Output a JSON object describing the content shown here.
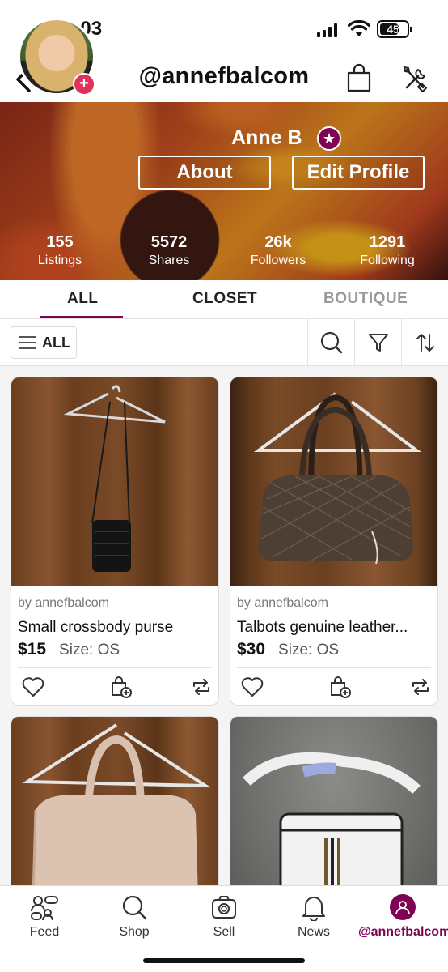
{
  "status": {
    "time": "3:03",
    "battery": "45"
  },
  "header": {
    "handle": "@annefbalcom"
  },
  "profile": {
    "name": "Anne B",
    "about_label": "About",
    "edit_label": "Edit Profile",
    "stats": [
      {
        "value": "155",
        "label": "Listings"
      },
      {
        "value": "5572",
        "label": "Shares"
      },
      {
        "value": "26k",
        "label": "Followers"
      },
      {
        "value": "1291",
        "label": "Following"
      }
    ]
  },
  "tabs": {
    "all": "ALL",
    "closet": "CLOSET",
    "boutique": "BOUTIQUE"
  },
  "filter": {
    "all_label": "ALL"
  },
  "listings": [
    {
      "by": "by annefbalcom",
      "title": "Small crossbody purse",
      "price": "$15",
      "size": "Size: OS"
    },
    {
      "by": "by annefbalcom",
      "title": "Talbots genuine leather...",
      "price": "$30",
      "size": "Size: OS"
    },
    {
      "by": "",
      "title": "",
      "price": "",
      "size": ""
    },
    {
      "by": "",
      "title": "",
      "price": "",
      "size": ""
    }
  ],
  "tabbar": {
    "feed": "Feed",
    "shop": "Shop",
    "sell": "Sell",
    "news": "News",
    "me": "@annefbalcom"
  },
  "colors": {
    "brand": "#7f0353",
    "plus_badge": "#e0335c"
  },
  "icons": [
    "back-chevron-icon",
    "shopping-bag-icon",
    "tools-icon",
    "star-icon",
    "search-icon",
    "filter-icon",
    "sort-icon",
    "heart-icon",
    "bundle-icon",
    "share-icon",
    "feed-icon",
    "shop-icon",
    "camera-icon",
    "bell-icon",
    "user-icon"
  ]
}
